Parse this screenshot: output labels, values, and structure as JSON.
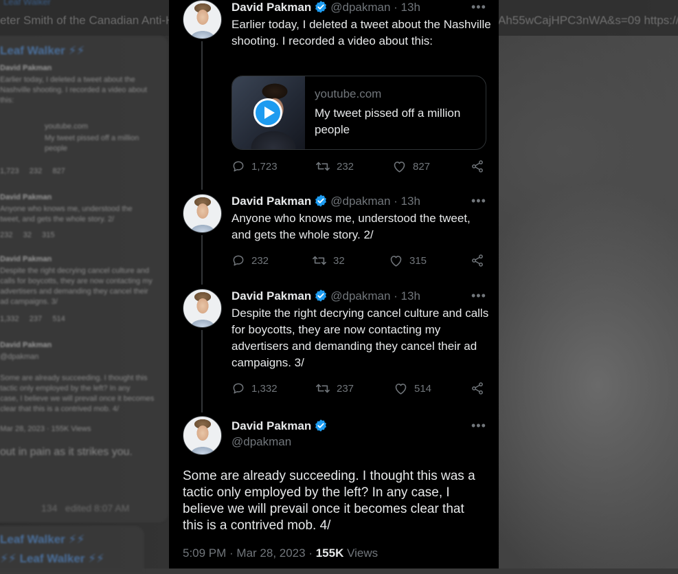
{
  "background": {
    "sender_top": "Leaf Walker",
    "link_left": "eter Smith of the Canadian Anti-H",
    "link_right": "Ah55wCajHPC3nWA&s=09 https://",
    "card_header": "Leaf Walker ⚡⚡",
    "mini_tweets": [
      {
        "name": "David Pakman",
        "text": "Earlier today, I deleted a tweet about the\nNashville shooting. I recorded a video about\nthis:",
        "card_domain": "youtube.com",
        "card_title": "My tweet pissed off a million\npeople",
        "stats": "1,723     232     827"
      },
      {
        "name": "David Pakman",
        "text": "Anyone who knows me, understood the\ntweet, and gets the whole story. 2/",
        "stats": "232     32     315"
      },
      {
        "name": "David Pakman",
        "text": "Despite the right decrying cancel culture and\ncalls for boycotts, they are now contacting my\nadvertisers and demanding they cancel their\nad campaigns. 3/",
        "stats": "1,332     237     514"
      },
      {
        "name": "David Pakman",
        "handle": "@dpakman",
        "text": "Some are already succeeding. I thought this\ntactic only employed by the left? In any\ncase, I believe we will prevail once it becomes\nclear that this is a contrived mob. 4/",
        "meta": "Mar 28, 2023 · 155K Views"
      }
    ],
    "caption": "out in pain as it strikes you.",
    "views_edited": "134   edited 8:07 AM",
    "next_sender": "Leaf Walker ⚡⚡",
    "next_reply": "⚡⚡ Leaf Walker ⚡⚡"
  },
  "tweets": [
    {
      "author": "David Pakman",
      "handle": "@dpakman · 13h",
      "text": "Earlier today, I deleted a tweet about the Nashville shooting. I recorded a video about this:",
      "card": {
        "domain": "youtube.com",
        "title": "My tweet pissed off a million people"
      },
      "replies": "1,723",
      "retweets": "232",
      "likes": "827"
    },
    {
      "author": "David Pakman",
      "handle": "@dpakman · 13h",
      "text": "Anyone who knows me, understood the tweet, and gets the whole story. 2/",
      "replies": "232",
      "retweets": "32",
      "likes": "315"
    },
    {
      "author": "David Pakman",
      "handle": "@dpakman · 13h",
      "text": "Despite the right decrying cancel culture and calls for boycotts, they are now contacting my advertisers and demanding they cancel their ad campaigns. 3/",
      "replies": "1,332",
      "retweets": "237",
      "likes": "514"
    }
  ],
  "main_tweet": {
    "author": "David Pakman",
    "handle": "@dpakman",
    "text": "Some are already succeeding. I thought this was a tactic only employed by the left? In any case, I believe we will prevail once it becomes clear that this is a contrived mob. 4/",
    "timestamp": "5:09 PM · Mar 28, 2023 · ",
    "views_count": "155K",
    "views_label": " Views"
  },
  "colors": {
    "accent": "#1d9bf0",
    "background": "#000000",
    "text": "#e7e9ea",
    "secondary": "#71767b"
  },
  "icons": [
    "verified-badge-icon",
    "more-icon",
    "reply-icon",
    "retweet-icon",
    "like-icon",
    "share-icon",
    "play-icon"
  ]
}
